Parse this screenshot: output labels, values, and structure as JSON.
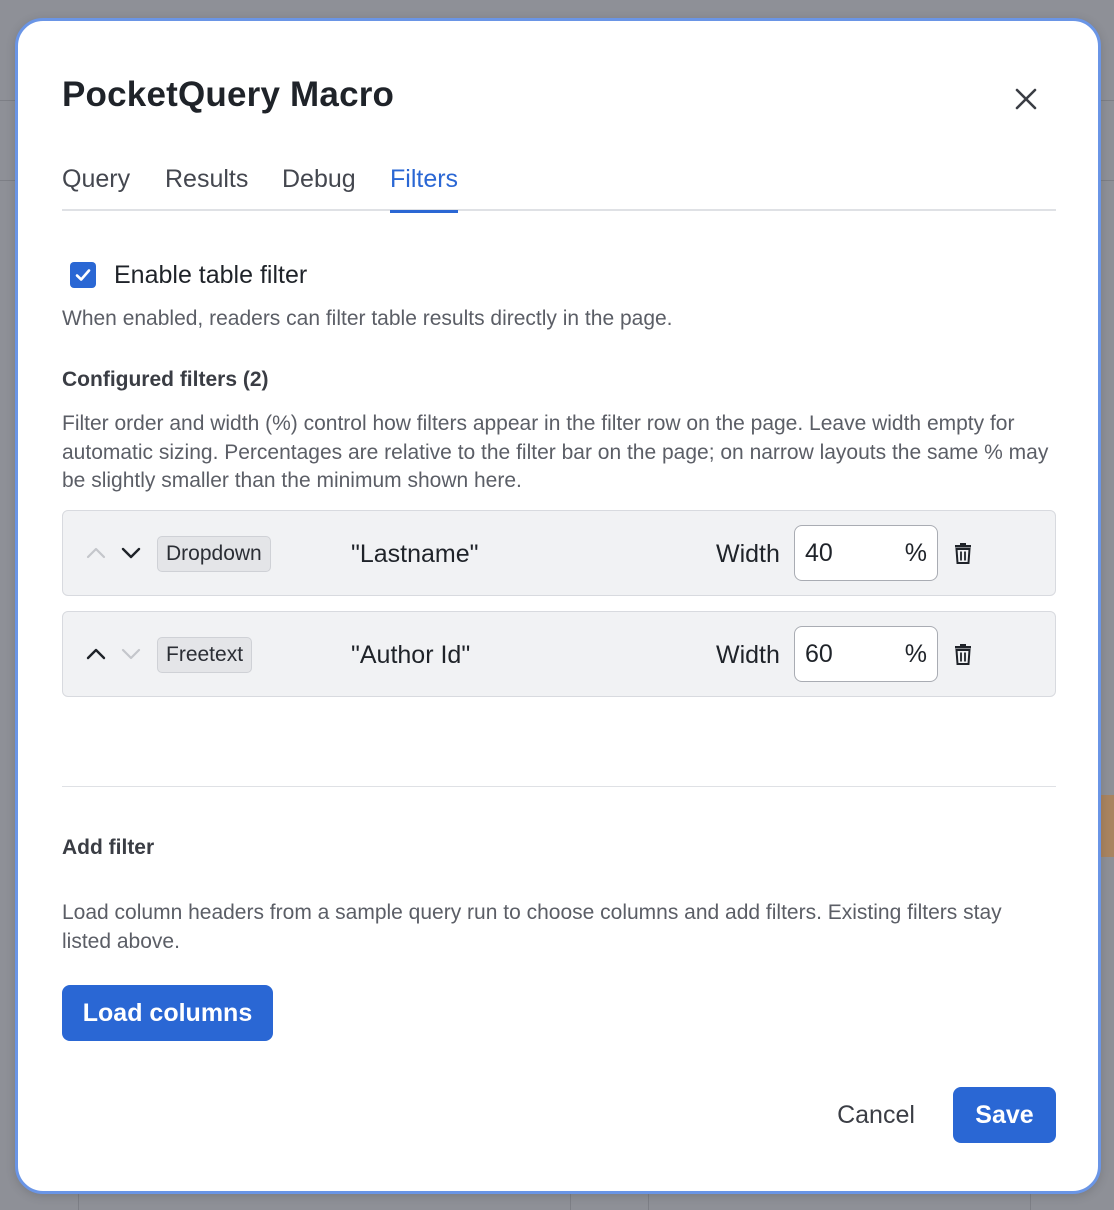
{
  "dialog": {
    "title": "PocketQuery Macro",
    "close_icon": "close-icon"
  },
  "tabs": [
    {
      "label": "Query",
      "active": false
    },
    {
      "label": "Results",
      "active": false
    },
    {
      "label": "Debug",
      "active": false
    },
    {
      "label": "Filters",
      "active": true
    }
  ],
  "enable_filter": {
    "checked": true,
    "label": "Enable table filter",
    "helper": "When enabled, readers can filter table results directly in the page."
  },
  "configured": {
    "title": "Configured filters (2)",
    "description": "Filter order and width (%) control how filters appear in the filter row on the page. Leave width empty for automatic sizing. Percentages are relative to the filter bar on the page; on narrow layouts the same % may be slightly smaller than the minimum shown here.",
    "filters": [
      {
        "type": "Dropdown",
        "column": "\"Lastname\"",
        "width_label": "Width",
        "width_value": "40",
        "unit": "%",
        "up_enabled": false,
        "down_enabled": true
      },
      {
        "type": "Freetext",
        "column": "\"Author Id\"",
        "width_label": "Width",
        "width_value": "60",
        "unit": "%",
        "up_enabled": true,
        "down_enabled": false
      }
    ]
  },
  "add_filter": {
    "title": "Add filter",
    "description": "Load column headers from a sample query run to choose columns and add filters. Existing filters stay listed above.",
    "load_button": "Load columns"
  },
  "footer": {
    "cancel": "Cancel",
    "save": "Save"
  },
  "colors": {
    "accent": "#2a67d4",
    "modal_border": "#6a95e6",
    "overlay": "#8e9097"
  }
}
